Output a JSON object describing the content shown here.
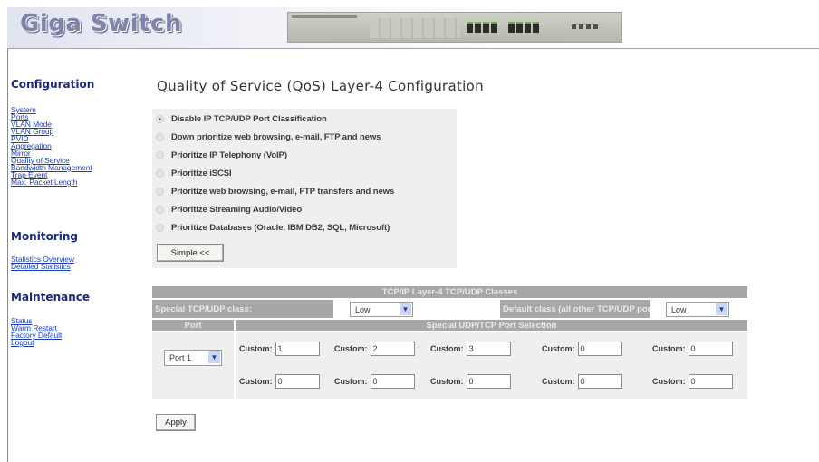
{
  "header": {
    "logo": "Giga Switch",
    "device_image": "switch-front-panel"
  },
  "sidebar": {
    "configuration": {
      "heading": "Configuration",
      "links": [
        "System",
        "Ports",
        "VLAN Mode",
        "VLAN Group",
        "PVID",
        "Aggregation",
        "Mirror",
        "Quality of Service",
        "Bandwidth Management",
        "Trap Event",
        "Max. Packet Length"
      ]
    },
    "monitoring": {
      "heading": "Monitoring",
      "links": [
        "Statistics Overview",
        "Detailed Statistics"
      ]
    },
    "maintenance": {
      "heading": "Maintenance",
      "links": [
        "Status",
        "Warm Restart",
        "Factory Default",
        "Logout"
      ]
    }
  },
  "main": {
    "title": "Quality of Service (QoS) Layer-4 Configuration",
    "options": [
      {
        "label": "Disable IP TCP/UDP Port Classification",
        "selected": true
      },
      {
        "label": "Down prioritize web browsing, e-mail, FTP and news",
        "selected": false
      },
      {
        "label": "Prioritize IP Telephony (VoIP)",
        "selected": false
      },
      {
        "label": "Prioritize iSCSI",
        "selected": false
      },
      {
        "label": "Prioritize web browsing, e-mail, FTP transfers and news",
        "selected": false
      },
      {
        "label": "Prioritize Streaming Audio/Video",
        "selected": false
      },
      {
        "label": "Prioritize Databases (Oracle, IBM DB2, SQL, Microsoft)",
        "selected": false
      }
    ],
    "simple_button": "Simple <<",
    "table": {
      "title": "TCP/IP Layer-4 TCP/UDP Classes",
      "special_class_label": "Special TCP/UDP class:",
      "special_class_value": "Low",
      "default_class_label": "Default class (all other TCP/UDP ports):",
      "default_class_value": "Low",
      "port_header": "Port",
      "selection_header": "Special UDP/TCP Port Selection",
      "port_value": "Port 1",
      "custom_label": "Custom:",
      "custom_values": [
        "1",
        "2",
        "3",
        "0",
        "0",
        "0",
        "0",
        "0",
        "0",
        "0"
      ]
    },
    "apply_button": "Apply"
  },
  "colors": {
    "link": "#1d3fbd",
    "heading": "#1a2a7a",
    "table_header": "#a7a7a7",
    "panel": "#efefef"
  }
}
